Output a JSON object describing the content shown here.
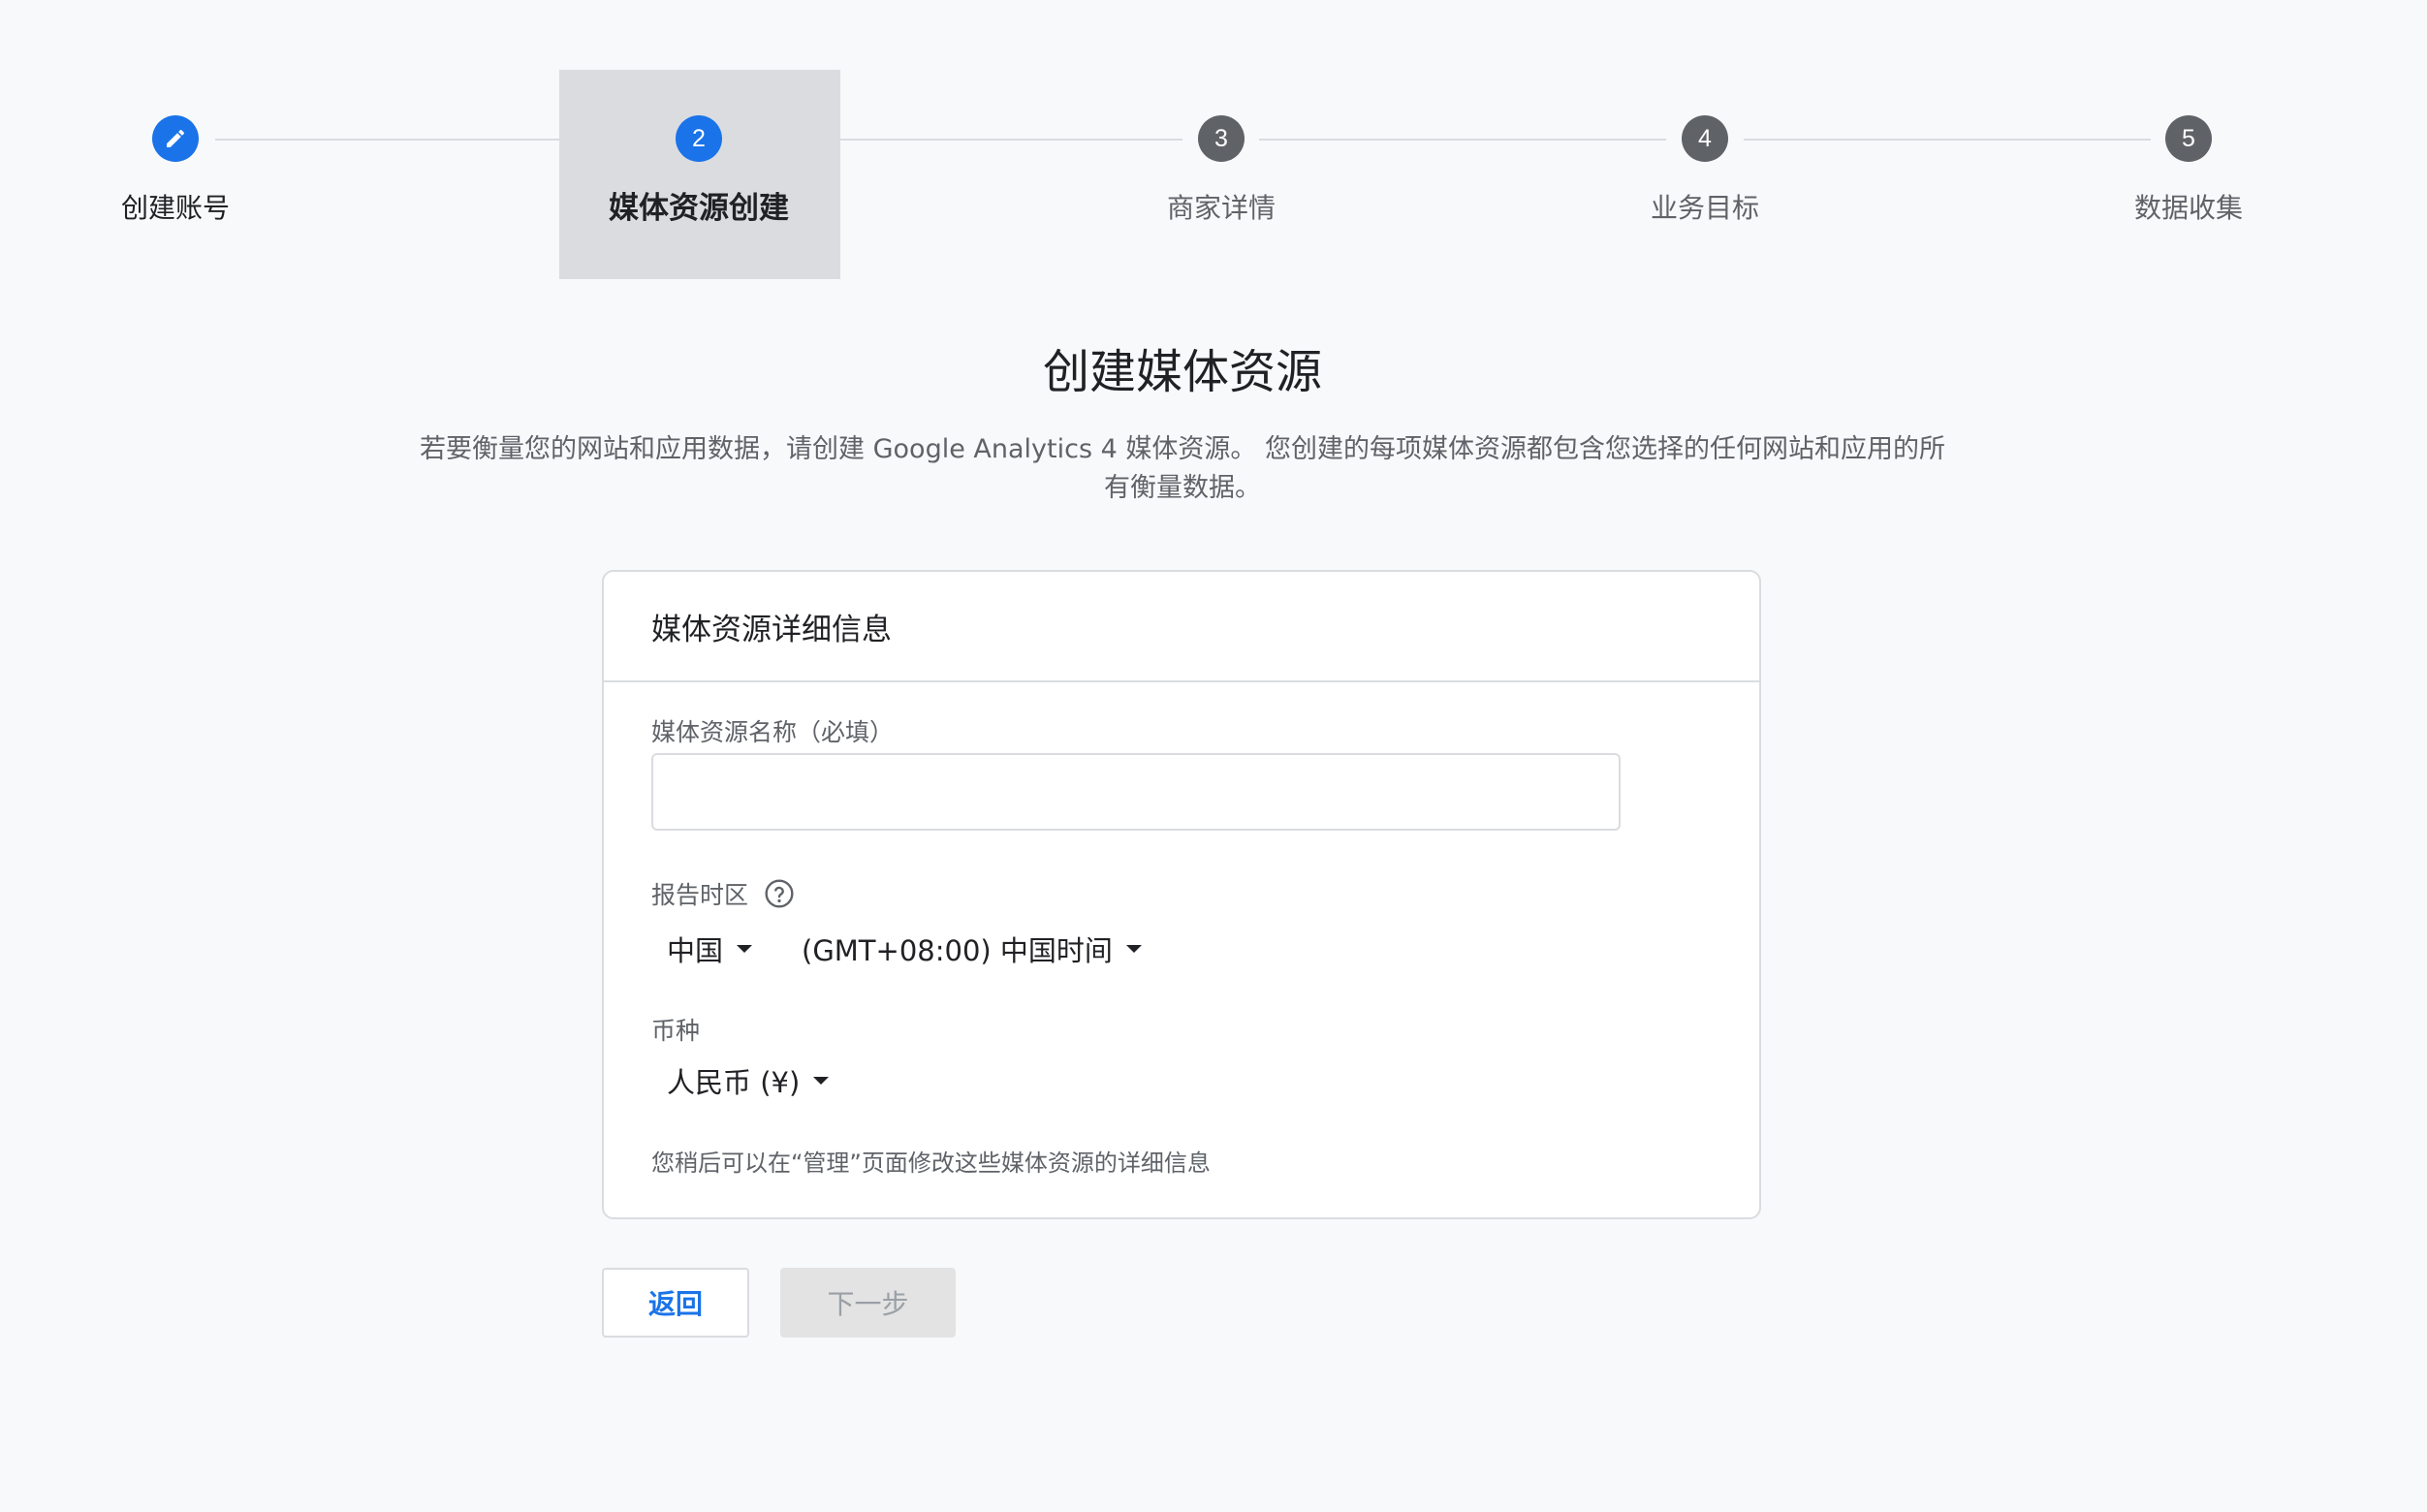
{
  "stepper": {
    "steps": [
      {
        "number": "",
        "label": "创建账号",
        "state": "done",
        "icon": "pencil-icon"
      },
      {
        "number": "2",
        "label": "媒体资源创建",
        "state": "active"
      },
      {
        "number": "3",
        "label": "商家详情",
        "state": "pending"
      },
      {
        "number": "4",
        "label": "业务目标",
        "state": "pending"
      },
      {
        "number": "5",
        "label": "数据收集",
        "state": "pending"
      }
    ]
  },
  "page": {
    "title": "创建媒体资源",
    "description": "若要衡量您的网站和应用数据，请创建 Google Analytics 4 媒体资源。 您创建的每项媒体资源都包含您选择的任何网站和应用的所有衡量数据。"
  },
  "card": {
    "title": "媒体资源详细信息",
    "property_name": {
      "label": "媒体资源名称（必填）",
      "value": ""
    },
    "timezone": {
      "label": "报告时区",
      "country": "中国",
      "zone": "(GMT+08:00) 中国时间"
    },
    "currency": {
      "label": "币种",
      "value": "人民币 (¥)"
    },
    "hint": "您稍后可以在“管理”页面修改这些媒体资源的详细信息"
  },
  "buttons": {
    "back": "返回",
    "next": "下一步"
  },
  "colors": {
    "accent": "#1a73e8",
    "step_pending": "#5f6368",
    "active_step_bg": "#dadce0"
  }
}
